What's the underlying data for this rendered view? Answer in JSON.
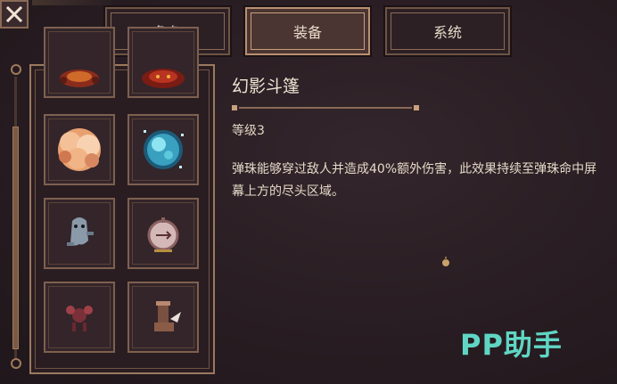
{
  "tabs": [
    {
      "label": "角色",
      "active": false
    },
    {
      "label": "装备",
      "active": true
    },
    {
      "label": "系统",
      "active": false
    }
  ],
  "inventory": {
    "slots": [
      {
        "icon": "red-crab-item-icon"
      },
      {
        "icon": "red-beetle-item-icon"
      },
      {
        "icon": "fiery-cloud-item-icon"
      },
      {
        "icon": "blue-crystal-orb-icon"
      },
      {
        "icon": "ghost-figure-icon"
      },
      {
        "icon": "pocket-watch-icon"
      },
      {
        "icon": "red-crab-figure-icon"
      },
      {
        "icon": "winged-boot-icon"
      }
    ]
  },
  "detail": {
    "name": "幻影斗篷",
    "level": "等级3",
    "description": "弹珠能够穿过敌人并造成40%额外伤害，此效果持续至弹珠命中屏幕上方的尽头区域。"
  },
  "watermark": {
    "text": "PP助手"
  },
  "colors": {
    "accent": "#caa07c",
    "watermark": "#5fd6c4",
    "background": "#2a1f24"
  }
}
